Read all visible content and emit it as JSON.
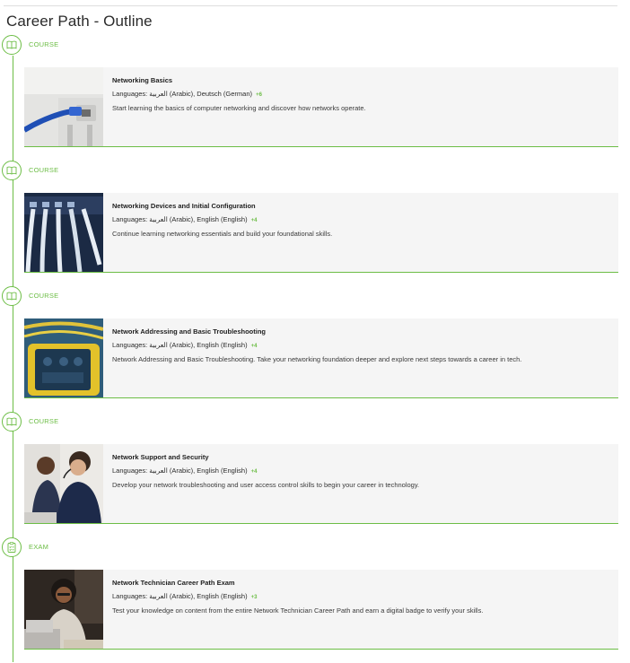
{
  "page": {
    "title": "Career Path - Outline"
  },
  "accent_color": "#6cbd45",
  "items": [
    {
      "type_label": "COURSE",
      "icon": "book-icon",
      "title": "Networking Basics",
      "languages_label": "Languages:",
      "languages": "العربية (Arabic), Deutsch (German)",
      "more_count": "+6",
      "description": "Start learning the basics of computer networking and discover how networks operate.",
      "image": "ethernet-cable-wall-port"
    },
    {
      "type_label": "COURSE",
      "icon": "book-icon",
      "title": "Networking Devices and Initial Configuration",
      "languages_label": "Languages:",
      "languages": "العربية (Arabic), English (English)",
      "more_count": "+4",
      "description": "Continue learning networking essentials and build your foundational skills.",
      "image": "network-switch-cables"
    },
    {
      "type_label": "COURSE",
      "icon": "book-icon",
      "title": "Network Addressing and Basic Troubleshooting",
      "languages_label": "Languages:",
      "languages": "العربية (Arabic), English (English)",
      "more_count": "+4",
      "description": "Network Addressing and Basic Troubleshooting. Take your networking foundation deeper and explore next steps towards a career in tech.",
      "image": "cable-tester-device"
    },
    {
      "type_label": "COURSE",
      "icon": "book-icon",
      "title": "Network Support and Security",
      "languages_label": "Languages:",
      "languages": "العربية (Arabic), English (English)",
      "more_count": "+4",
      "description": "Develop your network troubleshooting and user access control skills to begin your career in technology.",
      "image": "support-agents-headsets"
    },
    {
      "type_label": "EXAM",
      "icon": "checklist-icon",
      "title": "Network Technician Career Path Exam",
      "languages_label": "Languages:",
      "languages": "العربية (Arabic), English (English)",
      "more_count": "+3",
      "description": "Test your knowledge on content from the entire Network Technician Career Path and earn a digital badge to verify your skills.",
      "image": "student-with-laptop"
    }
  ]
}
